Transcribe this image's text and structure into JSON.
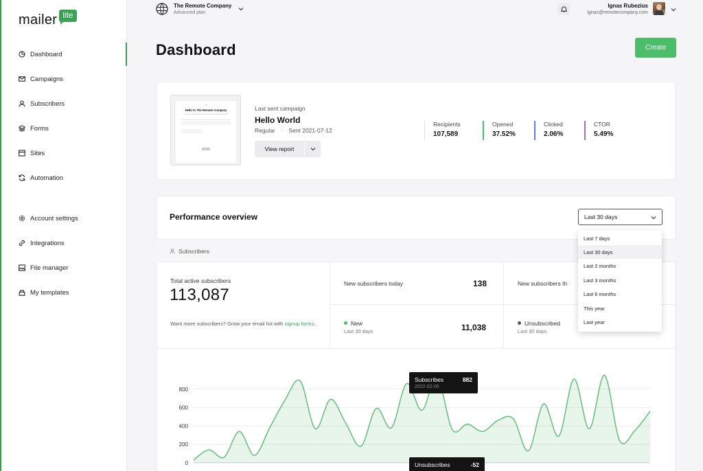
{
  "brand": {
    "name": "mailer",
    "badge": "lite",
    "accent": "#3aa353"
  },
  "company": {
    "name": "The Remote Company",
    "plan": "Advanced plan"
  },
  "user": {
    "name": "Ignas Rubezius",
    "email": "ignas@remotecompany.com"
  },
  "sidebar": {
    "items": [
      {
        "label": "Dashboard",
        "icon": "dashboard-icon"
      },
      {
        "label": "Campaigns",
        "icon": "envelope-icon"
      },
      {
        "label": "Subscribers",
        "icon": "user-icon"
      },
      {
        "label": "Forms",
        "icon": "forms-icon"
      },
      {
        "label": "Sites",
        "icon": "sites-icon"
      },
      {
        "label": "Automation",
        "icon": "automation-icon"
      },
      {
        "label": "Account settings",
        "icon": "gear-icon"
      },
      {
        "label": "Integrations",
        "icon": "link-icon"
      },
      {
        "label": "File manager",
        "icon": "image-icon"
      },
      {
        "label": "My templates",
        "icon": "templates-icon"
      }
    ]
  },
  "header": {
    "title": "Dashboard",
    "create_label": "Create"
  },
  "campaign": {
    "section_label": "Last sent campaign",
    "name": "Hello World",
    "type": "Regular",
    "sent": "Sent 2021-07-12",
    "view_report_label": "View report",
    "preview_heading": "Hello to The Remote Company",
    "stats": [
      {
        "label": "Recipients",
        "value": "107,589",
        "color": "#dddddd"
      },
      {
        "label": "Opened",
        "value": "37.52%",
        "color": "#4cbd6b"
      },
      {
        "label": "Clicked",
        "value": "2.06%",
        "color": "#5b7be8"
      },
      {
        "label": "CTOR",
        "value": "5.49%",
        "color": "#9b6ce8"
      }
    ]
  },
  "performance": {
    "title": "Performance overview",
    "range": "Last 30 days",
    "range_options": [
      "Last 7 days",
      "Last 30 days",
      "Last 2 months",
      "Last 3 months",
      "Last 6 months",
      "This year",
      "Last year"
    ],
    "tab_label": "Subscribers",
    "total_label": "Total active subscribers",
    "total_value": "113,087",
    "help_text": "Want more subscribers? Grow your email list with ",
    "help_link": "signup forms",
    "help_end": ".",
    "new_today_label": "New subscribers today",
    "new_today_value": "138",
    "new_this_label": "New subscribers th",
    "new_label": "New",
    "new_period": "Last 30 days",
    "new_value": "11,038",
    "unsub_label": "Unsubscribed",
    "unsub_period": "Last 30 days"
  },
  "chart_data": {
    "type": "area",
    "y_ticks": [
      "800",
      "600",
      "400",
      "200",
      "0"
    ],
    "ylim": [
      0,
      1000
    ],
    "grid": true,
    "series": [
      {
        "name": "Subscribes",
        "color": "#6cc080",
        "values": [
          30,
          140,
          60,
          340,
          80,
          380,
          680,
          890,
          370,
          690,
          430,
          180,
          590,
          380,
          860,
          570,
          930,
          360,
          420,
          340,
          460,
          480,
          130,
          640,
          290,
          910,
          370,
          950,
          240,
          350,
          560
        ]
      }
    ],
    "tooltip": {
      "label": "Subscribes",
      "value": "882",
      "date": "2022-02-05"
    },
    "tooltip2": {
      "label": "Unsubscribes",
      "value": "-52"
    }
  }
}
